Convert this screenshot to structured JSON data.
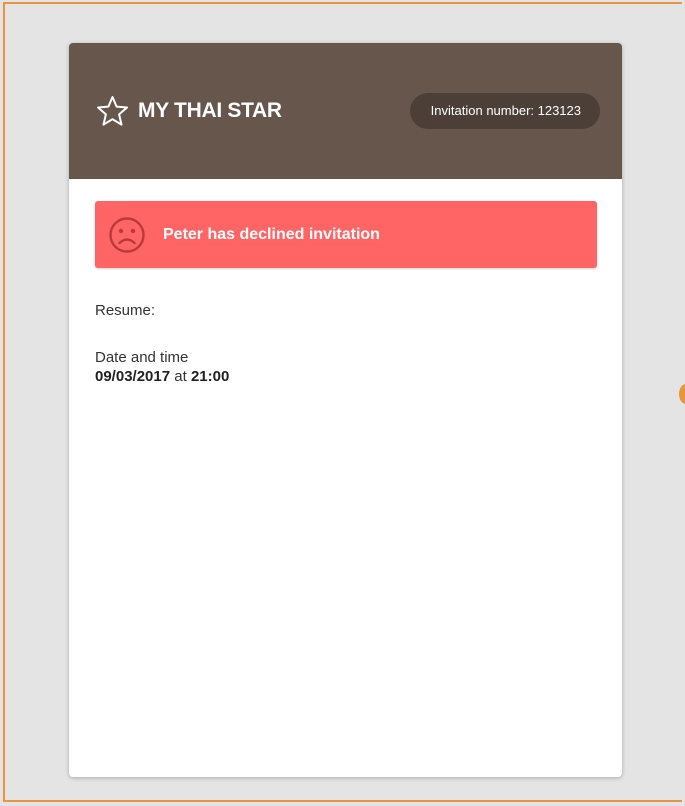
{
  "header": {
    "icon": "star-outline-icon",
    "title": "MY THAI STAR",
    "invitation_label": "Invitation number: 123123"
  },
  "alert": {
    "icon": "sad-face-icon",
    "message": "Peter has declined invitation",
    "color": "#ff6565"
  },
  "summary": {
    "resume_label": "Resume:",
    "datetime_label": "Date and time",
    "date": "09/03/2017",
    "connector": "at",
    "time": "21:00"
  },
  "colors": {
    "header_bg": "#66564b",
    "pill_bg": "#4b3f37",
    "frame_accent": "#e8953f",
    "page_bg": "#e4e4e4"
  }
}
